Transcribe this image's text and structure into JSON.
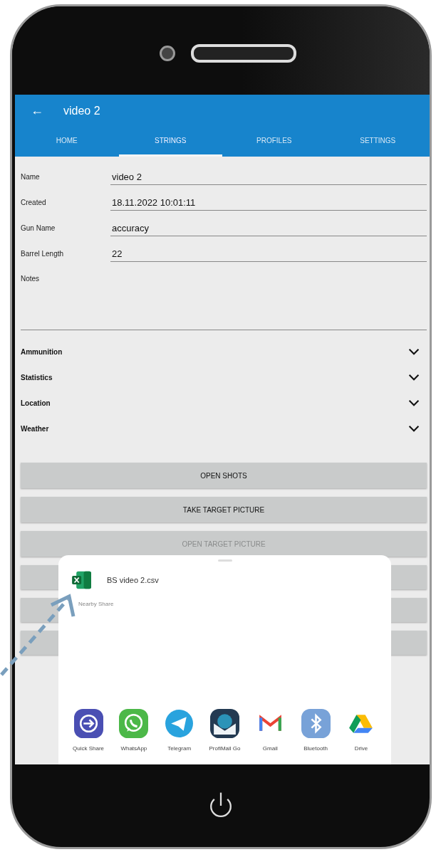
{
  "app_bar": {
    "back": "←",
    "title": "video 2"
  },
  "tabs": [
    {
      "label": "HOME",
      "selected": false
    },
    {
      "label": "STRINGS",
      "selected": true
    },
    {
      "label": "PROFILES",
      "selected": false
    },
    {
      "label": "SETTINGS",
      "selected": false
    }
  ],
  "fields": [
    {
      "label": "Name",
      "value": "video 2",
      "kind": "line"
    },
    {
      "label": "Created",
      "value": "18.11.2022 10:01:11",
      "kind": "line"
    },
    {
      "label": "Gun Name",
      "value": "accuracy",
      "kind": "line"
    },
    {
      "label": "Barrel Length",
      "value": "22",
      "kind": "line"
    },
    {
      "label": "Notes",
      "kind": "multiline"
    }
  ],
  "sections": [
    {
      "label": "Ammunition",
      "expanded": false
    },
    {
      "label": "Statistics",
      "expanded": false
    },
    {
      "label": "Location",
      "expanded": false
    },
    {
      "label": "Weather",
      "expanded": false
    }
  ],
  "buttons": [
    {
      "label": "OPEN SHOTS",
      "disabled": false
    },
    {
      "label": "TAKE TARGET PICTURE",
      "disabled": false
    },
    {
      "label": "OPEN TARGET PICTURE",
      "disabled": true
    }
  ],
  "share_sheet": {
    "file_name": "BS video 2.csv",
    "nearby_share": "Nearby Share",
    "apps": [
      {
        "name": "Quick Share",
        "kind": "quickshare"
      },
      {
        "name": "WhatsApp",
        "kind": "whatsapp"
      },
      {
        "name": "Telegram",
        "kind": "telegram"
      },
      {
        "name": "ProfiMail Go",
        "kind": "mail"
      },
      {
        "name": "Gmail",
        "kind": "gmail"
      },
      {
        "name": "Bluetooth",
        "kind": "bluetooth"
      },
      {
        "name": "Drive",
        "kind": "drive"
      }
    ]
  }
}
